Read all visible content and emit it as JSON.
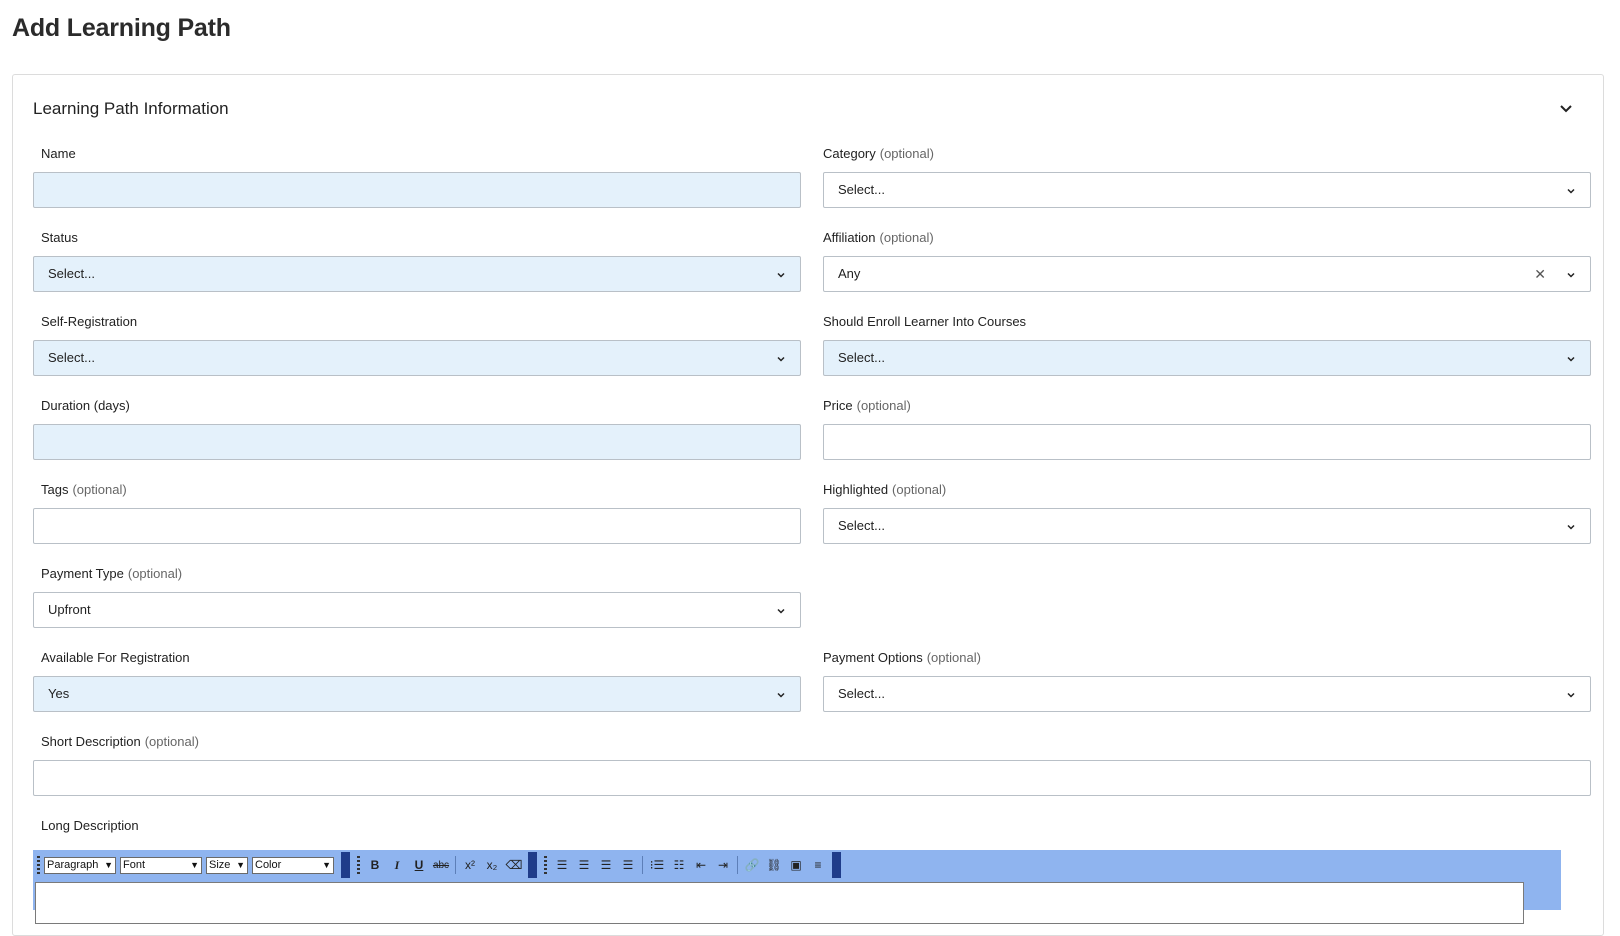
{
  "page": {
    "title": "Add Learning Path"
  },
  "section": {
    "title": "Learning Path Information"
  },
  "optional_text": "(optional)",
  "fields": {
    "name": {
      "label": "Name",
      "value": ""
    },
    "category": {
      "label": "Category",
      "value": "Select..."
    },
    "status": {
      "label": "Status",
      "value": "Select..."
    },
    "affiliation": {
      "label": "Affiliation",
      "value": "Any"
    },
    "self_registration": {
      "label": "Self-Registration",
      "value": "Select..."
    },
    "should_enroll": {
      "label": "Should Enroll Learner Into Courses",
      "value": "Select..."
    },
    "duration": {
      "label": "Duration (days)",
      "value": ""
    },
    "price": {
      "label": "Price",
      "value": ""
    },
    "tags": {
      "label": "Tags",
      "value": ""
    },
    "highlighted": {
      "label": "Highlighted",
      "value": "Select..."
    },
    "payment_type": {
      "label": "Payment Type",
      "value": "Upfront"
    },
    "available_for_registration": {
      "label": "Available For Registration",
      "value": "Yes"
    },
    "payment_options": {
      "label": "Payment Options",
      "value": "Select..."
    },
    "short_description": {
      "label": "Short Description",
      "value": ""
    },
    "long_description": {
      "label": "Long Description"
    }
  },
  "editor_toolbar": {
    "format": "Paragraph",
    "font": "Font",
    "size": "Size",
    "color": "Color",
    "bold": "B",
    "italic": "I",
    "underline": "U",
    "strike": "abc"
  },
  "colors": {
    "required_field_bg": "#e4f1fb",
    "editor_toolbar_bg": "#8fb4ef",
    "field_border": "#b9c0c7"
  }
}
